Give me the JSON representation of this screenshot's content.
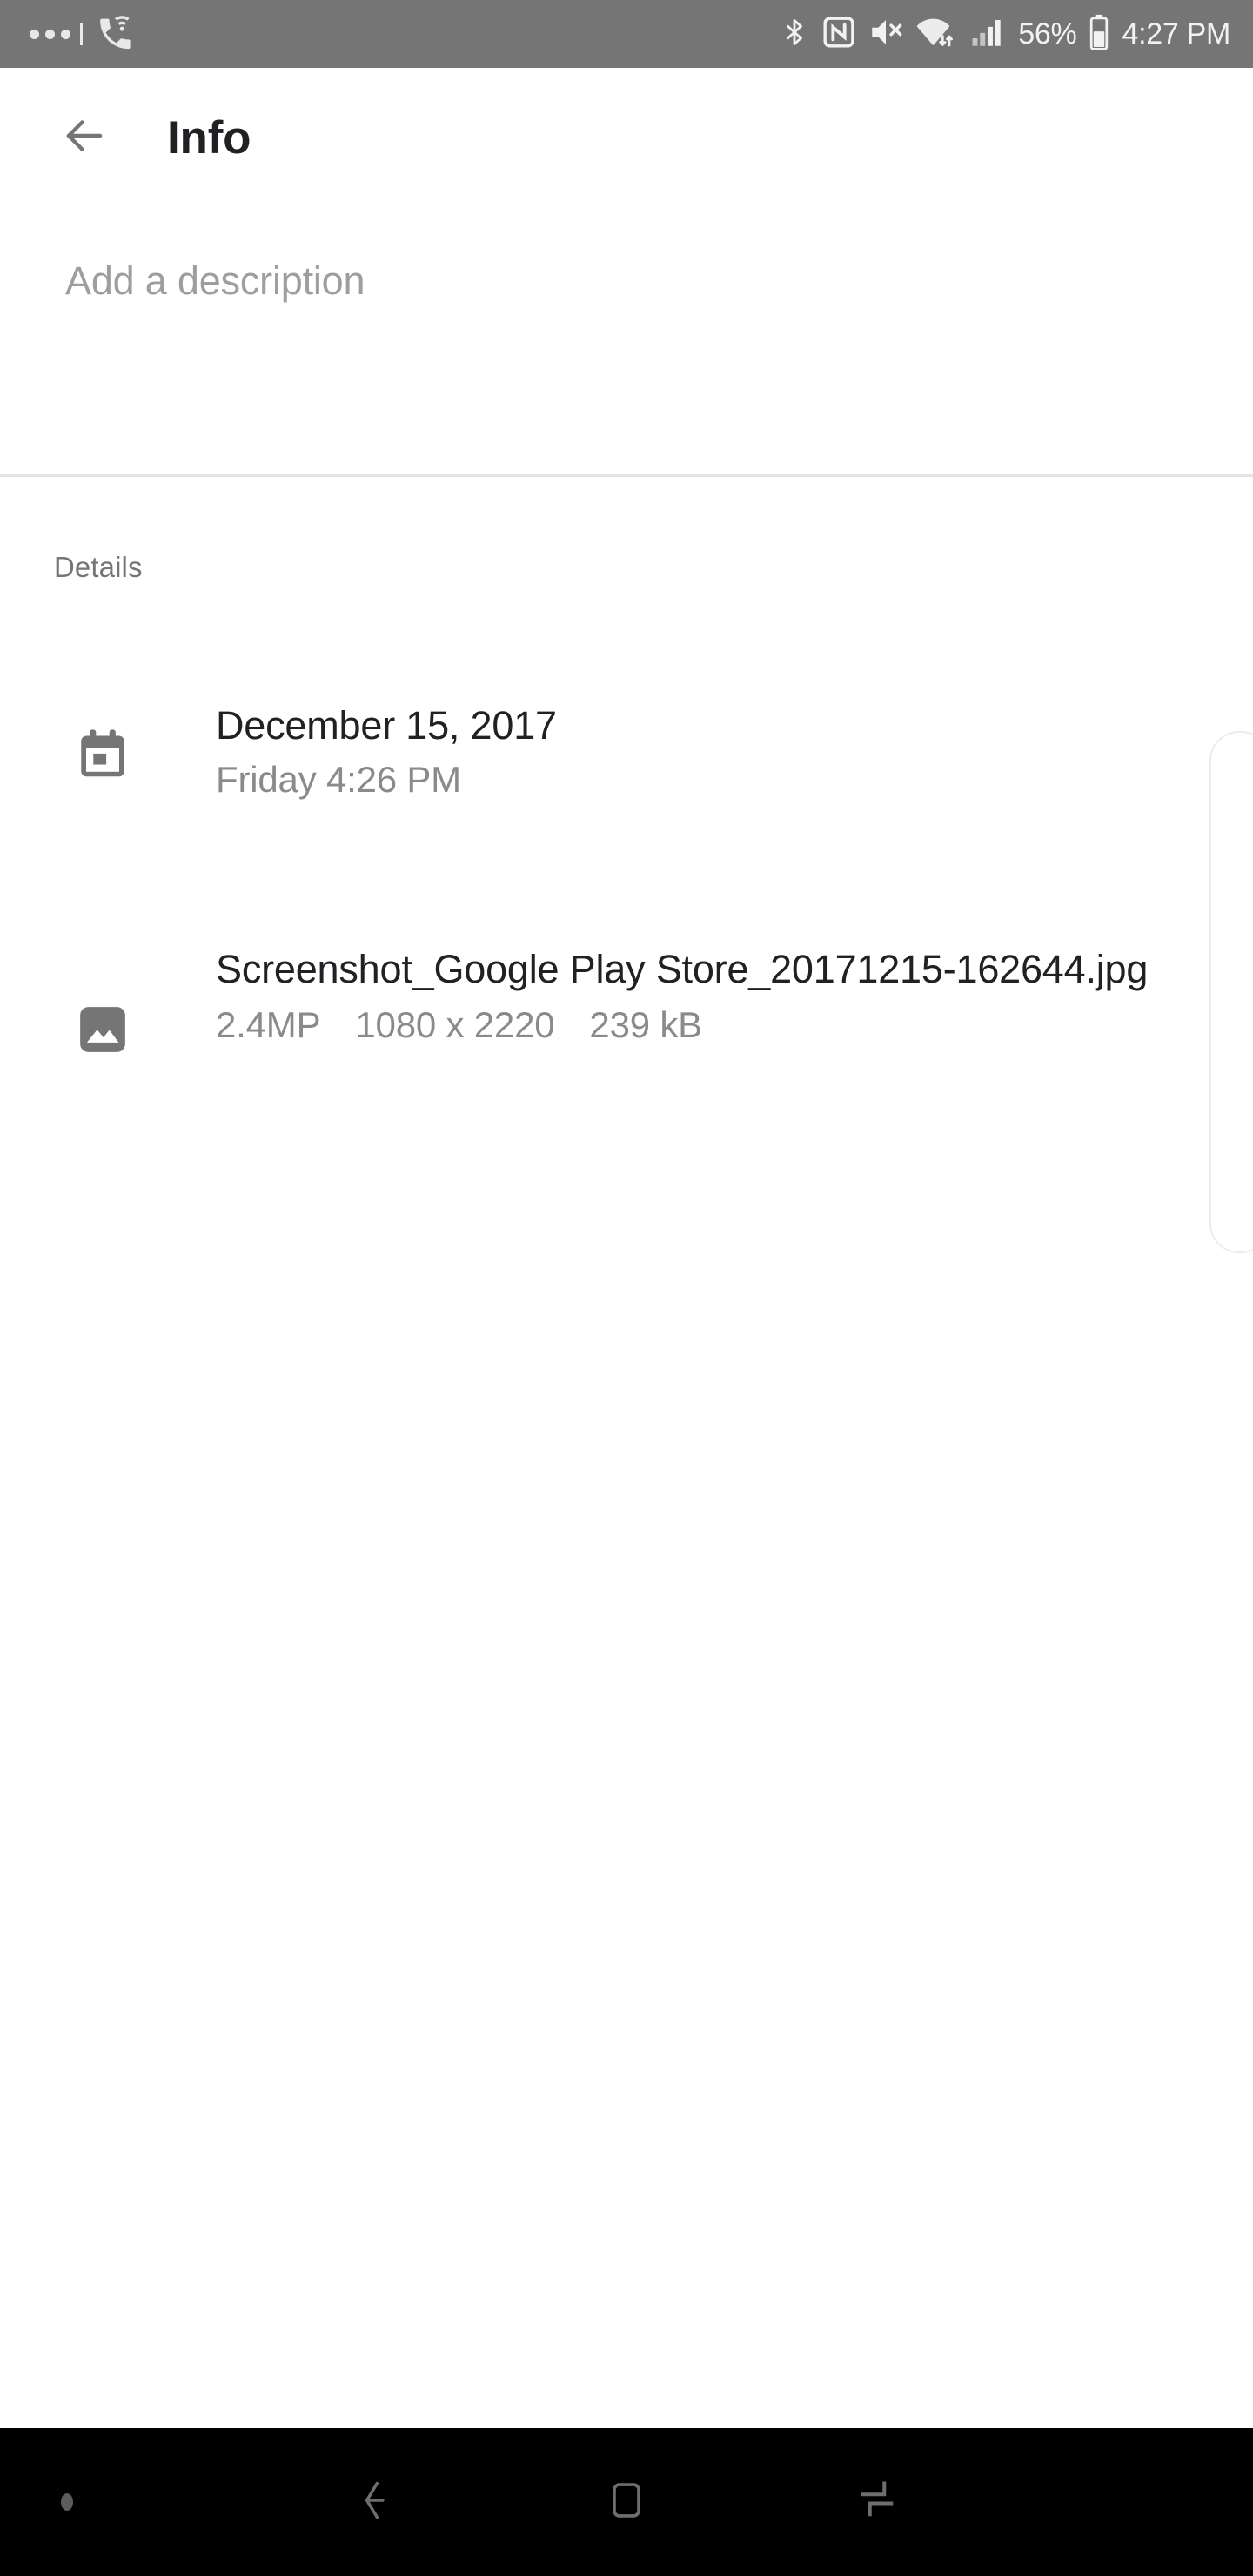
{
  "status_bar": {
    "background_color": "#757575",
    "left_icons": [
      {
        "name": "more-notifications-icon",
        "label": "•••"
      },
      {
        "name": "notification-divider",
        "label": "|"
      },
      {
        "name": "wifi-calling-icon",
        "label": "wifi-calling"
      }
    ],
    "right_icons": [
      {
        "name": "bluetooth-icon",
        "label": "bluetooth"
      },
      {
        "name": "nfc-icon",
        "label": "NFC"
      },
      {
        "name": "volume-mute-icon",
        "label": "mute"
      },
      {
        "name": "wifi-data-icon",
        "label": "wifi"
      },
      {
        "name": "cellular-signal-icon",
        "label": "signal"
      }
    ],
    "battery_percent": "56%",
    "battery_icon": "battery-icon",
    "clock": "4:27 PM"
  },
  "app_bar": {
    "back_icon": "back-arrow-icon",
    "title": "Info"
  },
  "description": {
    "placeholder": "Add a description",
    "value": ""
  },
  "details": {
    "section_label": "Details",
    "rows": [
      {
        "icon": "calendar-icon",
        "primary": "December 15, 2017",
        "secondary": "Friday 4:26 PM"
      },
      {
        "icon": "image-icon",
        "primary": "Screenshot_Google Play Store_20171215-162644.jpg",
        "meta": [
          "2.4MP",
          "1080 x 2220",
          "239 kB"
        ]
      }
    ]
  },
  "nav_bar": {
    "background_color": "#000000",
    "items": [
      {
        "name": "nav-indicator-dot",
        "label": "indicator"
      },
      {
        "name": "nav-back-icon",
        "label": "Back"
      },
      {
        "name": "nav-home-icon",
        "label": "Home"
      },
      {
        "name": "nav-recents-icon",
        "label": "Recents"
      }
    ]
  },
  "colors": {
    "status_bar": "#757575",
    "primary_text": "#202124",
    "secondary_text": "#8a8a8a",
    "label_text": "#757575",
    "placeholder_text": "#9e9e9e",
    "divider": "#e4e4e4",
    "icon_gray": "#757575",
    "nav_icon": "#5c5c5c"
  }
}
